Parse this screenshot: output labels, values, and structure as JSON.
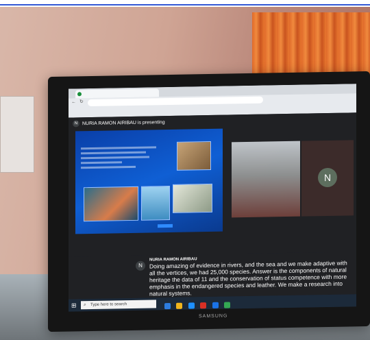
{
  "meeting": {
    "presenter_initial": "N",
    "presenter_banner": "NURIA RAMON AIRIBAU is presenting"
  },
  "participants": [
    {
      "initial": "N"
    }
  ],
  "captions": {
    "initial": "N",
    "speaker": "NURIA RAMON AIRIBAU",
    "text": "Doing amazing of evidence in rivers, and the sea and we make adaptive with all the vertices, we had 25,000 species. Answer is the components of natural heritage the data of 11 and the conservation of status competence with more emphasis in the endangered species and leather. We make a research into natural systems."
  },
  "taskbar": {
    "search_placeholder": "Type here to search"
  },
  "monitor": {
    "brand": "SAMSUNG"
  }
}
